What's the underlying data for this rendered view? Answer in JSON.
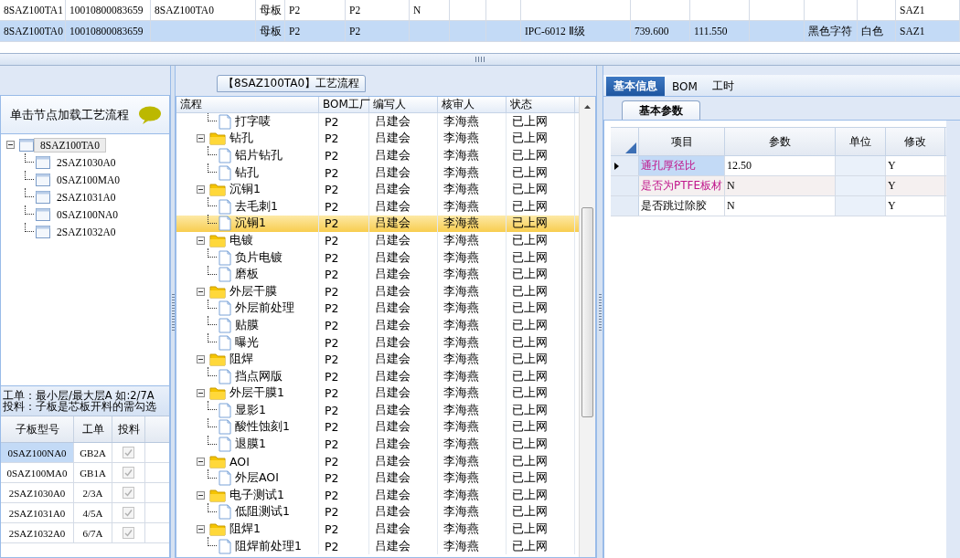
{
  "top_grid": {
    "rows": [
      {
        "selected": false,
        "cells": [
          "8SAZ100TA1",
          "10010800083659",
          "8SAZ100TA0",
          "母板",
          "P2",
          "P2",
          "N",
          "",
          "",
          "",
          "",
          "",
          "",
          "",
          "",
          "SAZ1"
        ]
      },
      {
        "selected": true,
        "cells": [
          "8SAZ100TA0",
          "10010800083659",
          "",
          "母板",
          "P2",
          "P2",
          "",
          "",
          "",
          "IPC-6012 Ⅱ级",
          "739.600",
          "111.550",
          "",
          "黑色字符",
          "白色",
          "SAZ1"
        ]
      }
    ]
  },
  "left_panel": {
    "header": "单击节点加载工艺流程",
    "tree": {
      "label": "8SAZ100TA0",
      "selected": true,
      "expanded": true,
      "children": [
        {
          "label": "2SAZ1030A0",
          "selected": false
        },
        {
          "label": "0SAZ100MA0",
          "selected": false
        },
        {
          "label": "2SAZ1031A0",
          "selected": false
        },
        {
          "label": "0SAZ100NA0",
          "selected": false
        },
        {
          "label": "2SAZ1032A0",
          "selected": false
        }
      ]
    },
    "notes": [
      "工单：最小层/最大层A 如:2/7A",
      "投料：子板是芯板开料的需勾选"
    ],
    "sub_table": {
      "columns": [
        "子板型号",
        "工单",
        "投料"
      ],
      "rows": [
        {
          "model": "0SAZ100NA0",
          "order": "GB2A",
          "checked": true,
          "selected": true
        },
        {
          "model": "0SAZ100MA0",
          "order": "GB1A",
          "checked": true,
          "selected": false
        },
        {
          "model": "2SAZ1030A0",
          "order": "2/3A",
          "checked": true,
          "selected": false
        },
        {
          "model": "2SAZ1031A0",
          "order": "4/5A",
          "checked": true,
          "selected": false
        },
        {
          "model": "2SAZ1032A0",
          "order": "6/7A",
          "checked": true,
          "selected": false
        }
      ]
    }
  },
  "process_panel": {
    "title": "【8SAZ100TA0】工艺流程",
    "columns": [
      "流程",
      "BOM工厂",
      "编写人",
      "核审人",
      "状态"
    ],
    "continued_children": [
      {
        "label": "打字唛",
        "cells": [
          "P2",
          "吕建会",
          "李海燕",
          "已上网"
        ],
        "selected": false
      }
    ],
    "tree": [
      {
        "label": "钻孔",
        "cells": [
          "P2",
          "吕建会",
          "李海燕",
          "已上网"
        ],
        "expanded": true,
        "selected": false,
        "children": [
          {
            "label": "铝片钻孔",
            "cells": [
              "P2",
              "吕建会",
              "李海燕",
              "已上网"
            ],
            "selected": false
          },
          {
            "label": "钻孔",
            "cells": [
              "P2",
              "吕建会",
              "李海燕",
              "已上网"
            ],
            "selected": false
          }
        ]
      },
      {
        "label": "沉铜1",
        "cells": [
          "P2",
          "吕建会",
          "李海燕",
          "已上网"
        ],
        "expanded": true,
        "selected": false,
        "children": [
          {
            "label": "去毛刺1",
            "cells": [
              "P2",
              "吕建会",
              "李海燕",
              "已上网"
            ],
            "selected": false
          },
          {
            "label": "沉铜1",
            "cells": [
              "P2",
              "吕建会",
              "李海燕",
              "已上网"
            ],
            "selected": true
          }
        ]
      },
      {
        "label": "电镀",
        "cells": [
          "P2",
          "吕建会",
          "李海燕",
          "已上网"
        ],
        "expanded": true,
        "selected": false,
        "children": [
          {
            "label": "负片电镀",
            "cells": [
              "P2",
              "吕建会",
              "李海燕",
              "已上网"
            ],
            "selected": false
          },
          {
            "label": "磨板",
            "cells": [
              "P2",
              "吕建会",
              "李海燕",
              "已上网"
            ],
            "selected": false
          }
        ]
      },
      {
        "label": "外层干膜",
        "cells": [
          "P2",
          "吕建会",
          "李海燕",
          "已上网"
        ],
        "expanded": true,
        "selected": false,
        "children": [
          {
            "label": "外层前处理",
            "cells": [
              "P2",
              "吕建会",
              "李海燕",
              "已上网"
            ],
            "selected": false
          },
          {
            "label": "贴膜",
            "cells": [
              "P2",
              "吕建会",
              "李海燕",
              "已上网"
            ],
            "selected": false
          },
          {
            "label": "曝光",
            "cells": [
              "P2",
              "吕建会",
              "李海燕",
              "已上网"
            ],
            "selected": false
          }
        ]
      },
      {
        "label": "阻焊",
        "cells": [
          "P2",
          "吕建会",
          "李海燕",
          "已上网"
        ],
        "expanded": true,
        "selected": false,
        "children": [
          {
            "label": "挡点网版",
            "cells": [
              "P2",
              "吕建会",
              "李海燕",
              "已上网"
            ],
            "selected": false
          }
        ]
      },
      {
        "label": "外层干膜1",
        "cells": [
          "P2",
          "吕建会",
          "李海燕",
          "已上网"
        ],
        "expanded": true,
        "selected": false,
        "children": [
          {
            "label": "显影1",
            "cells": [
              "P2",
              "吕建会",
              "李海燕",
              "已上网"
            ],
            "selected": false
          },
          {
            "label": "酸性蚀刻1",
            "cells": [
              "P2",
              "吕建会",
              "李海燕",
              "已上网"
            ],
            "selected": false
          },
          {
            "label": "退膜1",
            "cells": [
              "P2",
              "吕建会",
              "李海燕",
              "已上网"
            ],
            "selected": false
          }
        ]
      },
      {
        "label": "AOI",
        "cells": [
          "P2",
          "吕建会",
          "李海燕",
          "已上网"
        ],
        "expanded": true,
        "selected": false,
        "children": [
          {
            "label": "外层AOI",
            "cells": [
              "P2",
              "吕建会",
              "李海燕",
              "已上网"
            ],
            "selected": false
          }
        ]
      },
      {
        "label": "电子测试1",
        "cells": [
          "P2",
          "吕建会",
          "李海燕",
          "已上网"
        ],
        "expanded": true,
        "selected": false,
        "children": [
          {
            "label": "低阻测试1",
            "cells": [
              "P2",
              "吕建会",
              "李海燕",
              "已上网"
            ],
            "selected": false
          }
        ]
      },
      {
        "label": "阻焊1",
        "cells": [
          "P2",
          "吕建会",
          "李海燕",
          "已上网"
        ],
        "expanded": true,
        "selected": false,
        "children": [
          {
            "label": "阻焊前处理1",
            "cells": [
              "P2",
              "吕建会",
              "李海燕",
              "已上网"
            ],
            "selected": false
          }
        ]
      }
    ]
  },
  "info_panel": {
    "tabs": [
      {
        "label": "基本信息",
        "selected": true
      },
      {
        "label": "BOM",
        "selected": false
      },
      {
        "label": "工时",
        "selected": false
      }
    ],
    "sub_tab": "基本参数",
    "columns": [
      "项目",
      "参数",
      "单位",
      "修改"
    ],
    "rows": [
      {
        "item": "通孔厚径比",
        "value": "12.50",
        "unit": "",
        "editable": "Y",
        "highlighted": true,
        "selected": true
      },
      {
        "item": "是否为PTFE板材",
        "value": "N",
        "unit": "",
        "editable": "Y",
        "highlighted": true,
        "selected": false
      },
      {
        "item": "是否跳过除胶",
        "value": "N",
        "unit": "",
        "editable": "Y",
        "highlighted": false,
        "selected": false
      }
    ]
  }
}
